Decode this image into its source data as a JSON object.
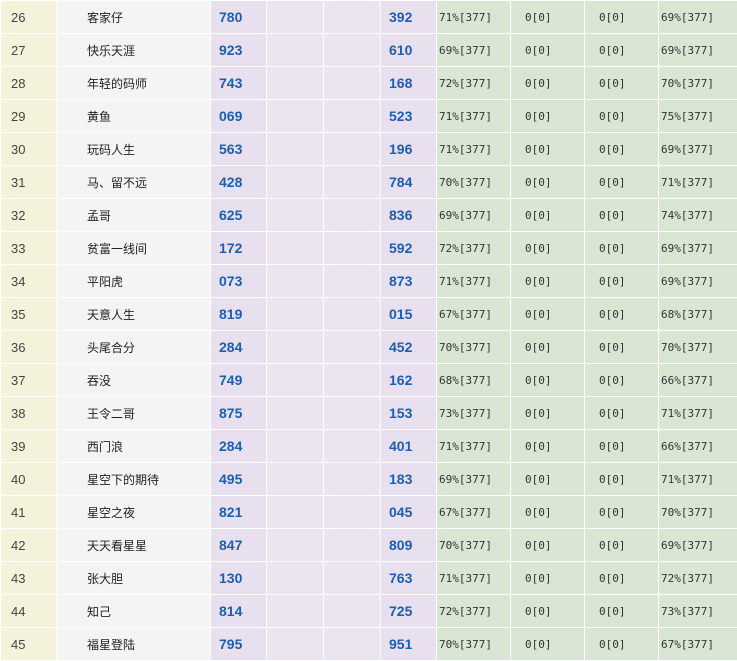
{
  "rows": [
    {
      "rank": "26",
      "name": "客家仔",
      "n1": "780",
      "n2": "392",
      "p1": "71%[377]",
      "p2": "0[0]",
      "p3": "0[0]",
      "p4": "69%[377]"
    },
    {
      "rank": "27",
      "name": "快乐天涯",
      "n1": "923",
      "n2": "610",
      "p1": "69%[377]",
      "p2": "0[0]",
      "p3": "0[0]",
      "p4": "69%[377]"
    },
    {
      "rank": "28",
      "name": "年轻的码师",
      "n1": "743",
      "n2": "168",
      "p1": "72%[377]",
      "p2": "0[0]",
      "p3": "0[0]",
      "p4": "70%[377]"
    },
    {
      "rank": "29",
      "name": "黄鱼",
      "n1": "069",
      "n2": "523",
      "p1": "71%[377]",
      "p2": "0[0]",
      "p3": "0[0]",
      "p4": "75%[377]"
    },
    {
      "rank": "30",
      "name": "玩码人生",
      "n1": "563",
      "n2": "196",
      "p1": "71%[377]",
      "p2": "0[0]",
      "p3": "0[0]",
      "p4": "69%[377]"
    },
    {
      "rank": "31",
      "name": "马、留不远",
      "n1": "428",
      "n2": "784",
      "p1": "70%[377]",
      "p2": "0[0]",
      "p3": "0[0]",
      "p4": "71%[377]"
    },
    {
      "rank": "32",
      "name": "孟哥",
      "n1": "625",
      "n2": "836",
      "p1": "69%[377]",
      "p2": "0[0]",
      "p3": "0[0]",
      "p4": "74%[377]"
    },
    {
      "rank": "33",
      "name": "贫富一线间",
      "n1": "172",
      "n2": "592",
      "p1": "72%[377]",
      "p2": "0[0]",
      "p3": "0[0]",
      "p4": "69%[377]"
    },
    {
      "rank": "34",
      "name": "平阳虎",
      "n1": "073",
      "n2": "873",
      "p1": "71%[377]",
      "p2": "0[0]",
      "p3": "0[0]",
      "p4": "69%[377]"
    },
    {
      "rank": "35",
      "name": "天意人生",
      "n1": "819",
      "n2": "015",
      "p1": "67%[377]",
      "p2": "0[0]",
      "p3": "0[0]",
      "p4": "68%[377]"
    },
    {
      "rank": "36",
      "name": "头尾合分",
      "n1": "284",
      "n2": "452",
      "p1": "70%[377]",
      "p2": "0[0]",
      "p3": "0[0]",
      "p4": "70%[377]"
    },
    {
      "rank": "37",
      "name": "吞没",
      "n1": "749",
      "n2": "162",
      "p1": "68%[377]",
      "p2": "0[0]",
      "p3": "0[0]",
      "p4": "66%[377]"
    },
    {
      "rank": "38",
      "name": "王令二哥",
      "n1": "875",
      "n2": "153",
      "p1": "73%[377]",
      "p2": "0[0]",
      "p3": "0[0]",
      "p4": "71%[377]"
    },
    {
      "rank": "39",
      "name": "西门浪",
      "n1": "284",
      "n2": "401",
      "p1": "71%[377]",
      "p2": "0[0]",
      "p3": "0[0]",
      "p4": "66%[377]"
    },
    {
      "rank": "40",
      "name": "星空下的期待",
      "n1": "495",
      "n2": "183",
      "p1": "69%[377]",
      "p2": "0[0]",
      "p3": "0[0]",
      "p4": "71%[377]"
    },
    {
      "rank": "41",
      "name": "星空之夜",
      "n1": "821",
      "n2": "045",
      "p1": "67%[377]",
      "p2": "0[0]",
      "p3": "0[0]",
      "p4": "70%[377]"
    },
    {
      "rank": "42",
      "name": "天天看星星",
      "n1": "847",
      "n2": "809",
      "p1": "70%[377]",
      "p2": "0[0]",
      "p3": "0[0]",
      "p4": "69%[377]"
    },
    {
      "rank": "43",
      "name": "张大胆",
      "n1": "130",
      "n2": "763",
      "p1": "71%[377]",
      "p2": "0[0]",
      "p3": "0[0]",
      "p4": "72%[377]"
    },
    {
      "rank": "44",
      "name": "知己",
      "n1": "814",
      "n2": "725",
      "p1": "72%[377]",
      "p2": "0[0]",
      "p3": "0[0]",
      "p4": "73%[377]"
    },
    {
      "rank": "45",
      "name": "福星登陆",
      "n1": "795",
      "n2": "951",
      "p1": "70%[377]",
      "p2": "0[0]",
      "p3": "0[0]",
      "p4": "67%[377]"
    }
  ]
}
